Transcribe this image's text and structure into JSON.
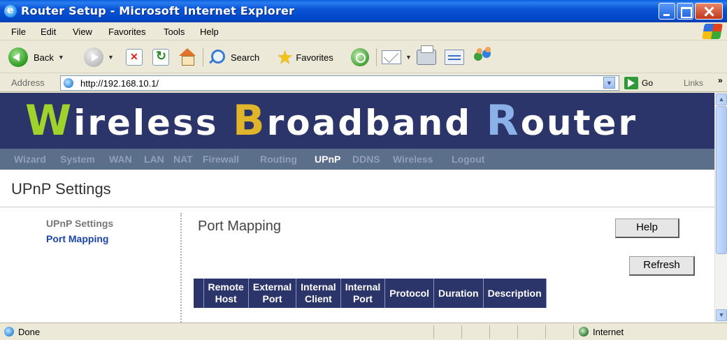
{
  "window": {
    "title": "Router Setup - Microsoft Internet Explorer"
  },
  "menu": [
    "File",
    "Edit",
    "View",
    "Favorites",
    "Tools",
    "Help"
  ],
  "toolbar": {
    "back_label": "Back",
    "search_label": "Search",
    "favorites_label": "Favorites"
  },
  "address": {
    "label": "Address",
    "url": "http://192.168.10.1/",
    "go_label": "Go",
    "links_label": "Links",
    "more": "»"
  },
  "banner": {
    "cap1": "W",
    "rest1": "ireless ",
    "cap2": "B",
    "rest2": "roadband ",
    "cap3": "R",
    "rest3": "outer"
  },
  "nav": {
    "items": [
      "Wizard",
      "System",
      "WAN",
      "LAN",
      "NAT",
      "Firewall",
      "Routing",
      "UPnP",
      "DDNS",
      "Wireless",
      "Logout"
    ],
    "active": "UPnP"
  },
  "page": {
    "heading": "UPnP Settings"
  },
  "sidebar": {
    "items": [
      "UPnP Settings",
      "Port Mapping"
    ],
    "active": "Port Mapping"
  },
  "content": {
    "title": "Port Mapping",
    "help_label": "Help",
    "refresh_label": "Refresh",
    "columns": [
      "Remote\nHost",
      "External\nPort",
      "Internal\nClient",
      "Internal\nPort",
      "Protocol",
      "Duration",
      "Description"
    ]
  },
  "status": {
    "text": "Done",
    "zone": "Internet"
  },
  "colors": {
    "banner_bg": "#2c3569",
    "nav_bg": "#5b6e8a",
    "active_link": "#1a44a8"
  }
}
